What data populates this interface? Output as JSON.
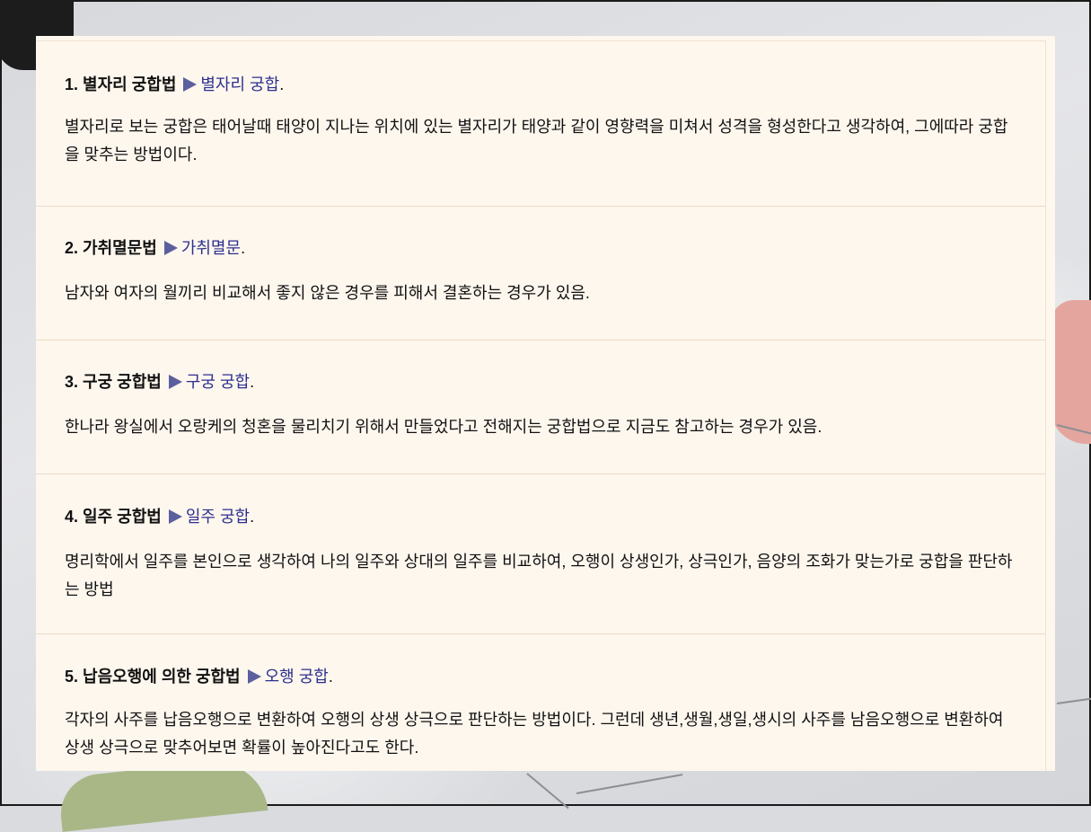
{
  "colors": {
    "panel_bg": "#fef7ee",
    "link": "#2d2f8f",
    "arrow": "#5c5f9e",
    "divider": "#eadbc8"
  },
  "sections": [
    {
      "title": "1. 별자리 궁합법",
      "link": "별자리 궁합",
      "body": "별자리로 보는 궁합은 태어날때 태양이 지나는 위치에 있는 별자리가 태양과 같이 영향력을 미쳐서 성격을 형성한다고 생각하여, 그에따라 궁합을 맞추는 방법이다."
    },
    {
      "title": "2. 가취멸문법",
      "link": "가취멸문",
      "body": "남자와 여자의 월끼리 비교해서 좋지 않은 경우를 피해서 결혼하는 경우가 있음."
    },
    {
      "title": "3. 구궁 궁합법",
      "link": "구궁 궁합",
      "body": "한나라 왕실에서 오랑케의 청혼을 물리치기 위해서 만들었다고 전해지는 궁합법으로 지금도 참고하는 경우가 있음."
    },
    {
      "title": "4. 일주 궁합법",
      "link": "일주 궁합",
      "body": "명리학에서 일주를 본인으로 생각하여 나의 일주와 상대의 일주를 비교하여, 오행이 상생인가, 상극인가, 음양의 조화가 맞는가로 궁합을 판단하는 방법"
    },
    {
      "title": "5. 납음오행에 의한 궁합법",
      "link": "오행 궁합",
      "body": "각자의 사주를 납음오행으로 변환하여 오행의 상생 상극으로 판단하는 방법이다. 그런데 생년,생월,생일,생시의 사주를 남음오행으로 변환하여 상생 상극으로 맞추어보면 확률이 높아진다고도 한다."
    }
  ]
}
